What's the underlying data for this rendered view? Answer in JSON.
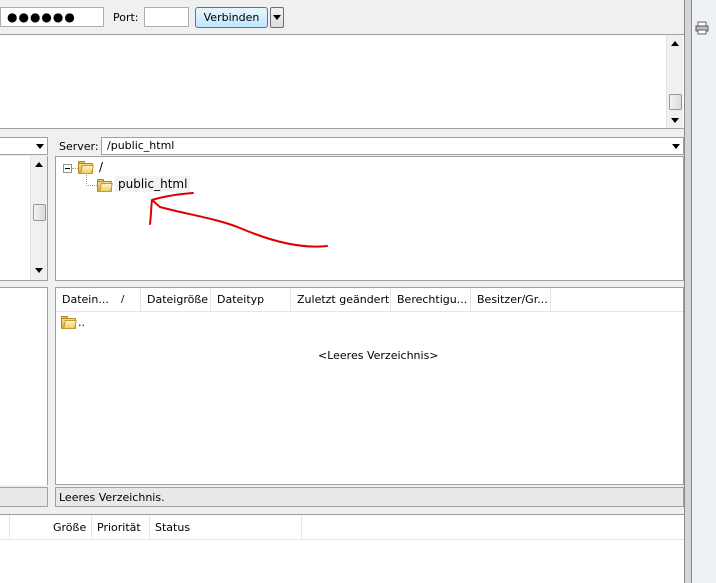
{
  "quickconnect": {
    "password_value": "●●●●●●",
    "port_label": "Port:",
    "port_value": "",
    "connect_label": "Verbinden"
  },
  "remote": {
    "server_label": "Server:",
    "path": "/public_html",
    "tree_root": "/",
    "tree_child": "public_html",
    "columns": [
      "Datein...",
      "Dateigröße",
      "Dateityp",
      "Zuletzt geändert",
      "Berechtigu...",
      "Besitzer/Gr..."
    ],
    "sort_indicator": "/",
    "parent_entry": "..",
    "empty_message": "<Leeres Verzeichnis>",
    "status": "Leeres Verzeichnis."
  },
  "queue": {
    "columns": [
      "Größe",
      "Priorität",
      "Status"
    ]
  },
  "annotation": {
    "color": "#e00000"
  }
}
